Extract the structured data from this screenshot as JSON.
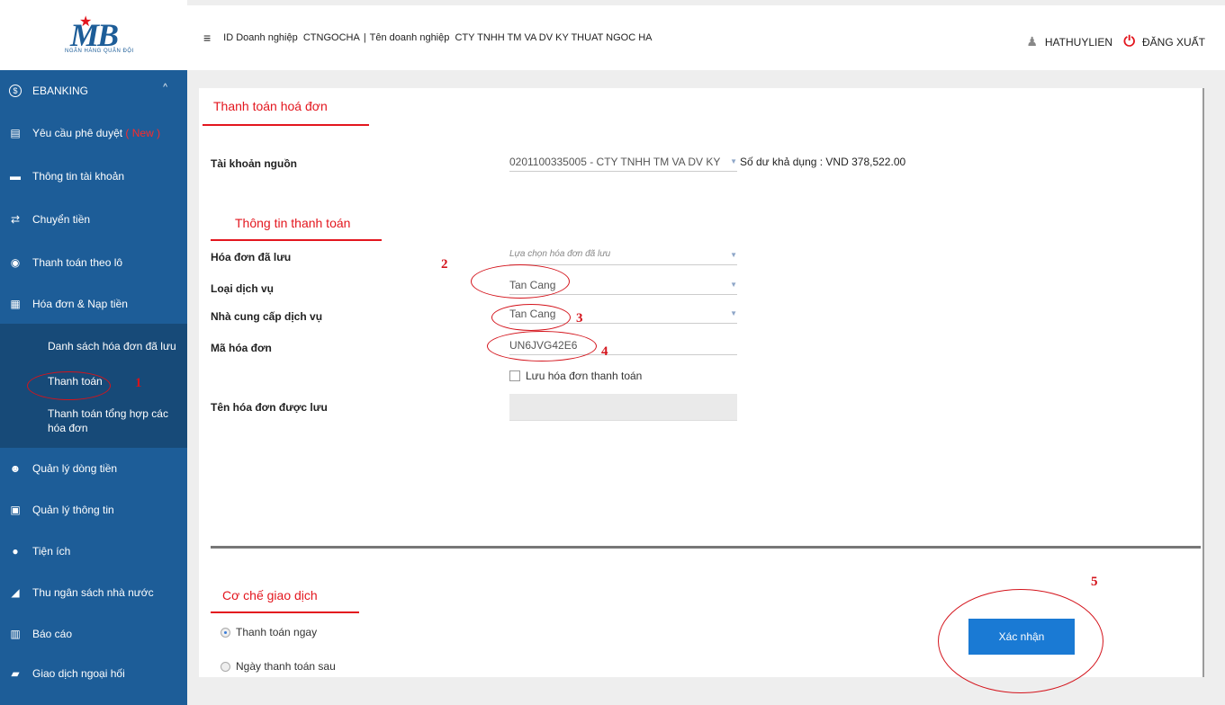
{
  "header": {
    "id_label": "ID Doanh nghiệp",
    "id_value": "CTNGOCHA",
    "separator": "|",
    "company_label": "Tên doanh nghiệp",
    "company_value": "CTY TNHH TM VA DV KY THUAT NGOC HA",
    "username": "HATHUYLIEN",
    "logout": "ĐĂNG XUẤT"
  },
  "logo": {
    "text": "MB",
    "subtitle": "NGÂN HÀNG QUÂN ĐỘI"
  },
  "sidebar": {
    "section": "EBANKING",
    "items": [
      {
        "label": "Yêu cầu phê duyệt",
        "badge": "( New )",
        "icon": "document-icon"
      },
      {
        "label": "Thông tin tài khoản",
        "icon": "wallet-icon"
      },
      {
        "label": "Chuyển tiền",
        "icon": "transfer-icon"
      },
      {
        "label": "Thanh toán theo lô",
        "icon": "coins-icon"
      },
      {
        "label": "Hóa đơn & Nạp tiền",
        "icon": "invoice-icon"
      }
    ],
    "subitems": [
      "Danh sách hóa đơn đã lưu",
      "Thanh toán",
      "Thanh toán tổng hợp các hóa đơn"
    ],
    "items2": [
      {
        "label": "Quản lý dòng tiền",
        "icon": "cashflow-icon"
      },
      {
        "label": "Quản lý thông tin",
        "icon": "id-card-icon"
      },
      {
        "label": "Tiện ích",
        "icon": "utility-icon"
      },
      {
        "label": "Thu ngân sách nhà nước",
        "icon": "state-budget-icon"
      },
      {
        "label": "Báo cáo",
        "icon": "report-icon"
      },
      {
        "label": "Giao dịch ngoại hối",
        "icon": "forex-icon"
      }
    ]
  },
  "form": {
    "title": "Thanh toán hoá đơn",
    "source_label": "Tài khoản nguồn",
    "source_value": "0201100335005 - CTY TNHH TM VA DV KY",
    "balance": "Số dư khả dụng : VND 378,522.00",
    "section_payment": "Thông tin thanh toán",
    "saved_label": "Hóa đơn đã lưu",
    "saved_placeholder": "Lựa chọn hóa đơn đã lưu",
    "service_label": "Loại dịch vụ",
    "service_value": "Tan Cang",
    "provider_label": "Nhà cung cấp dịch vụ",
    "provider_value": "Tan Cang",
    "code_label": "Mã hóa đơn",
    "code_value": "UN6JVG42E6",
    "save_checkbox": "Lưu hóa đơn thanh toán",
    "save_name_label": "Tên hóa đơn được lưu",
    "section_mechanism": "Cơ chế giao dịch",
    "radio_now": "Thanh toán ngay",
    "radio_later": "Ngày thanh toán sau",
    "confirm": "Xác nhận"
  },
  "annotations": [
    "1",
    "2",
    "3",
    "4",
    "5"
  ]
}
